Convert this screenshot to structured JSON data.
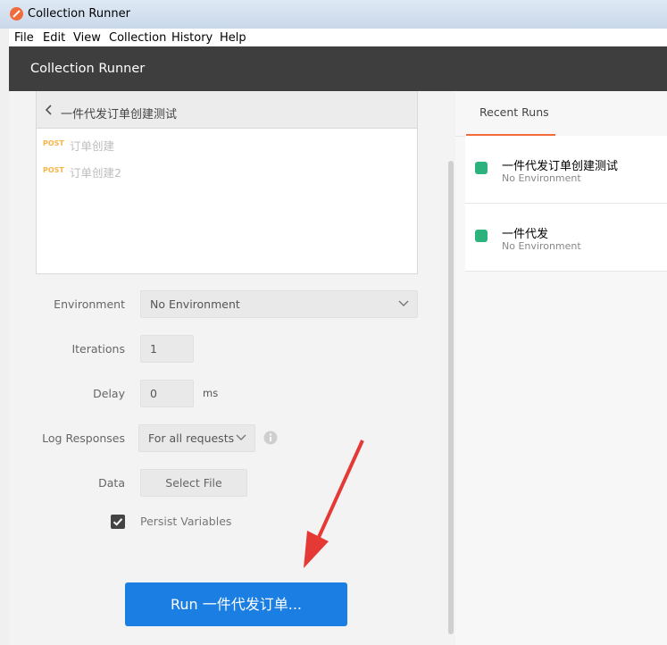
{
  "window": {
    "title": "Collection Runner"
  },
  "menu": [
    "File",
    "Edit",
    "View",
    "Collection",
    "History",
    "Help"
  ],
  "header": {
    "title": "Collection Runner"
  },
  "collection": {
    "name": "一件代发订单创建测试",
    "requests": [
      {
        "method": "POST",
        "name": "订单创建"
      },
      {
        "method": "POST",
        "name": "订单创建2"
      }
    ]
  },
  "form": {
    "environment_label": "Environment",
    "environment_value": "No Environment",
    "iterations_label": "Iterations",
    "iterations_value": "1",
    "delay_label": "Delay",
    "delay_value": "0",
    "delay_unit": "ms",
    "log_label": "Log Responses",
    "log_value": "For all requests",
    "data_label": "Data",
    "select_file": "Select File",
    "persist_label": "Persist Variables",
    "persist_checked": true
  },
  "run_button": "Run 一件代发订单...",
  "recent": {
    "tab_label": "Recent Runs",
    "runs": [
      {
        "name": "一件代发订单创建测试",
        "env": "No Environment"
      },
      {
        "name": "一件代发",
        "env": "No Environment"
      }
    ]
  },
  "colors": {
    "accent": "#f26b3a",
    "run_button": "#1a7ee3",
    "status": "#2db27d",
    "header": "#3e3e3e"
  }
}
